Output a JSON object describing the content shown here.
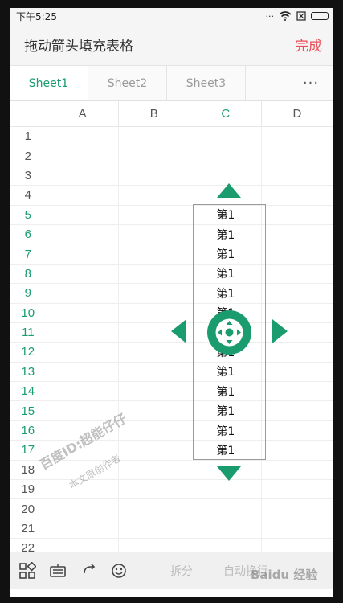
{
  "status": {
    "time": "下午5:25",
    "dots": "···"
  },
  "header": {
    "title": "拖动箭头填充表格",
    "done_label": "完成"
  },
  "sheets": [
    {
      "label": "Sheet1",
      "active": true
    },
    {
      "label": "Sheet2",
      "active": false
    },
    {
      "label": "Sheet3",
      "active": false
    }
  ],
  "more_label": "···",
  "columns": [
    {
      "label": "A",
      "active": false
    },
    {
      "label": "B",
      "active": false
    },
    {
      "label": "C",
      "active": true
    },
    {
      "label": "D",
      "active": false
    }
  ],
  "rows": [
    {
      "n": "1",
      "c": ""
    },
    {
      "n": "2",
      "c": ""
    },
    {
      "n": "3",
      "c": ""
    },
    {
      "n": "4",
      "c": ""
    },
    {
      "n": "5",
      "c": "第1"
    },
    {
      "n": "6",
      "c": "第1"
    },
    {
      "n": "7",
      "c": "第1"
    },
    {
      "n": "8",
      "c": "第1"
    },
    {
      "n": "9",
      "c": "第1"
    },
    {
      "n": "10",
      "c": "第1"
    },
    {
      "n": "11",
      "c": "第1"
    },
    {
      "n": "12",
      "c": "第1"
    },
    {
      "n": "13",
      "c": "第1"
    },
    {
      "n": "14",
      "c": "第1"
    },
    {
      "n": "15",
      "c": "第1"
    },
    {
      "n": "16",
      "c": "第1"
    },
    {
      "n": "17",
      "c": "第1"
    },
    {
      "n": "18",
      "c": ""
    },
    {
      "n": "19",
      "c": ""
    },
    {
      "n": "20",
      "c": ""
    },
    {
      "n": "21",
      "c": ""
    },
    {
      "n": "22",
      "c": ""
    }
  ],
  "toolbar": {
    "split_label": "拆分",
    "wrap_label": "自动换行"
  },
  "watermark": {
    "line1": "百度ID:超能仔仔",
    "line2": "本文原创作者",
    "baidu": "Baidu 经验"
  },
  "accent": "#1a9c6f"
}
